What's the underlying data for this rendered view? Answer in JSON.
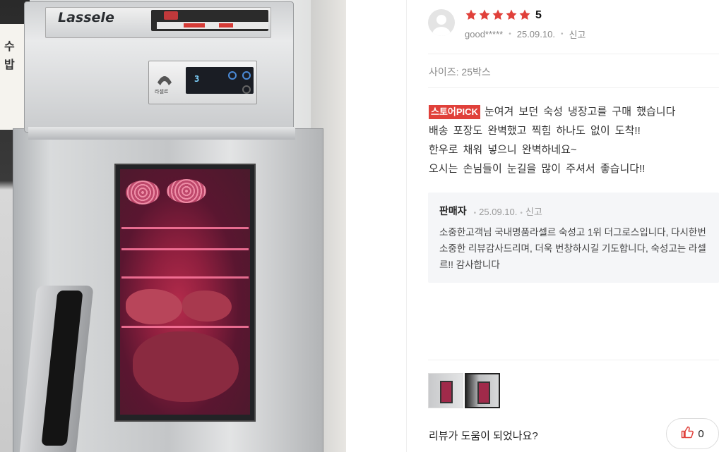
{
  "photo": {
    "brand_logo": "Lassele",
    "panel_brand": "라셀르",
    "display_value": "3",
    "sign_left_chars": [
      "수",
      "밥"
    ]
  },
  "review": {
    "rating": "5",
    "star_count": 5,
    "star_color": "#e0403a",
    "author": "good*****",
    "date": "25.09.10.",
    "report_label": "신고",
    "option": "사이즈: 25박스",
    "badge": "스토어PICK",
    "body_lines": [
      "눈여겨 보던 숙성 냉장고를  구매 했습니다",
      "배송 포장도 완벽했고 찍힘 하나도 없이 도착!!",
      "한우로 채워 넣으니 완벽하네요~",
      "오시는 손님들이 눈길을 많이 주셔서 좋습니다!!"
    ]
  },
  "reply": {
    "author": "판매자",
    "date": "25.09.10.",
    "report_label": "신고",
    "text": "소중한고객님 국내명품라셀르 숙성고 1위 더그로스입니다, 다시한번 소중한 리뷰감사드리며, 더욱 번창하시길 기도합니다, 숙성고는 라셀르!! 감사합니다"
  },
  "footer": {
    "helpful_question": "리뷰가 도움이 되었나요?",
    "like_count": "0"
  },
  "thumbnails": {
    "count": 2,
    "active_index": 1
  }
}
